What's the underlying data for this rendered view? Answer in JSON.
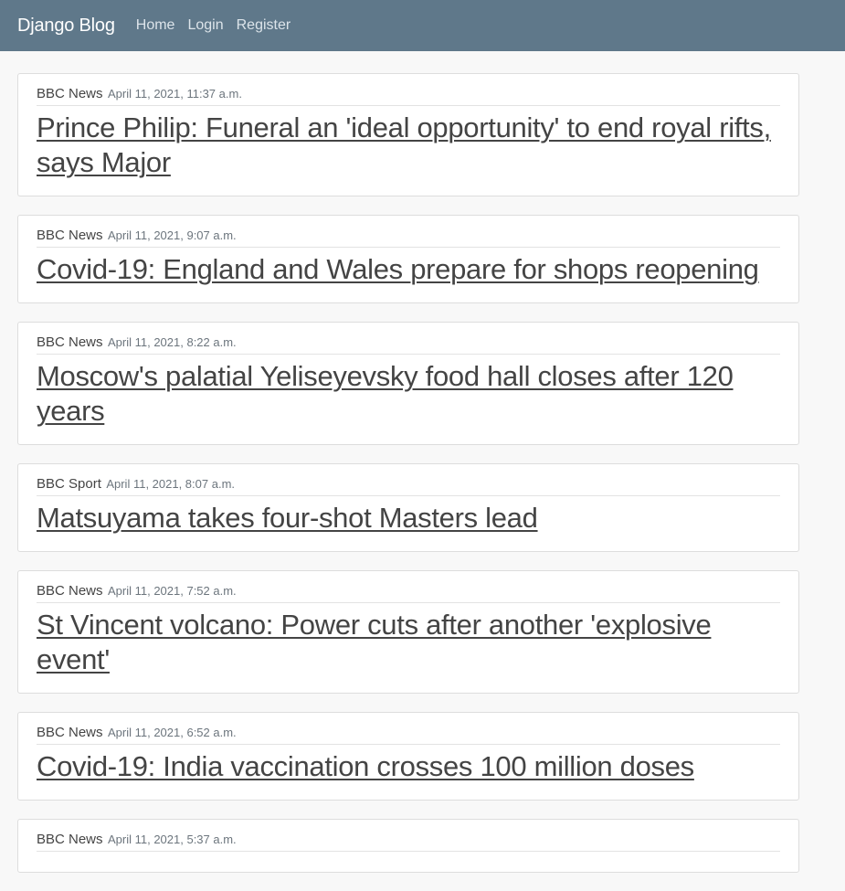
{
  "navbar": {
    "brand": "Django Blog",
    "links": [
      "Home",
      "Login",
      "Register"
    ]
  },
  "posts": [
    {
      "source": "BBC News",
      "date": "April 11, 2021, 11:37 a.m.",
      "title": "Prince Philip: Funeral an 'ideal opportunity' to end royal rifts, says Major"
    },
    {
      "source": "BBC News",
      "date": "April 11, 2021, 9:07 a.m.",
      "title": "Covid-19: England and Wales prepare for shops reopening"
    },
    {
      "source": "BBC News",
      "date": "April 11, 2021, 8:22 a.m.",
      "title": "Moscow's palatial Yeliseyevsky food hall closes after 120 years"
    },
    {
      "source": "BBC Sport",
      "date": "April 11, 2021, 8:07 a.m.",
      "title": "Matsuyama takes four-shot Masters lead"
    },
    {
      "source": "BBC News",
      "date": "April 11, 2021, 7:52 a.m.",
      "title": "St Vincent volcano: Power cuts after another 'explosive event'"
    },
    {
      "source": "BBC News",
      "date": "April 11, 2021, 6:52 a.m.",
      "title": "Covid-19: India vaccination crosses 100 million doses"
    },
    {
      "source": "BBC News",
      "date": "April 11, 2021, 5:37 a.m.",
      "title": ""
    }
  ]
}
